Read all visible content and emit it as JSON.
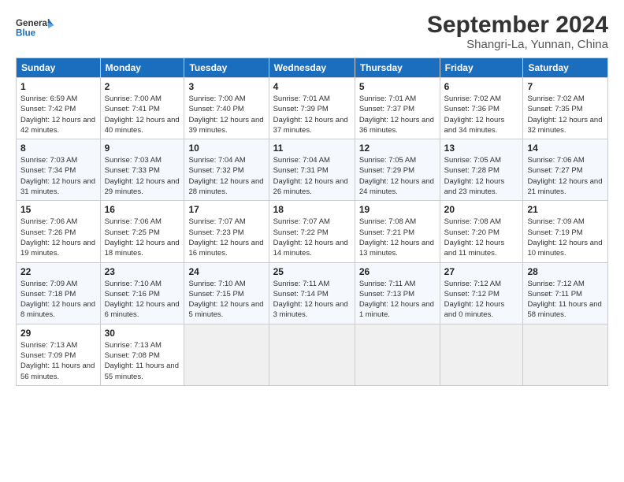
{
  "logo": {
    "line1": "General",
    "line2": "Blue"
  },
  "title": "September 2024",
  "subtitle": "Shangri-La, Yunnan, China",
  "days_of_week": [
    "Sunday",
    "Monday",
    "Tuesday",
    "Wednesday",
    "Thursday",
    "Friday",
    "Saturday"
  ],
  "weeks": [
    [
      {
        "day": "1",
        "sunrise": "6:59 AM",
        "sunset": "7:42 PM",
        "daylight": "12 hours and 42 minutes."
      },
      {
        "day": "2",
        "sunrise": "7:00 AM",
        "sunset": "7:41 PM",
        "daylight": "12 hours and 40 minutes."
      },
      {
        "day": "3",
        "sunrise": "7:00 AM",
        "sunset": "7:40 PM",
        "daylight": "12 hours and 39 minutes."
      },
      {
        "day": "4",
        "sunrise": "7:01 AM",
        "sunset": "7:39 PM",
        "daylight": "12 hours and 37 minutes."
      },
      {
        "day": "5",
        "sunrise": "7:01 AM",
        "sunset": "7:37 PM",
        "daylight": "12 hours and 36 minutes."
      },
      {
        "day": "6",
        "sunrise": "7:02 AM",
        "sunset": "7:36 PM",
        "daylight": "12 hours and 34 minutes."
      },
      {
        "day": "7",
        "sunrise": "7:02 AM",
        "sunset": "7:35 PM",
        "daylight": "12 hours and 32 minutes."
      }
    ],
    [
      {
        "day": "8",
        "sunrise": "7:03 AM",
        "sunset": "7:34 PM",
        "daylight": "12 hours and 31 minutes."
      },
      {
        "day": "9",
        "sunrise": "7:03 AM",
        "sunset": "7:33 PM",
        "daylight": "12 hours and 29 minutes."
      },
      {
        "day": "10",
        "sunrise": "7:04 AM",
        "sunset": "7:32 PM",
        "daylight": "12 hours and 28 minutes."
      },
      {
        "day": "11",
        "sunrise": "7:04 AM",
        "sunset": "7:31 PM",
        "daylight": "12 hours and 26 minutes."
      },
      {
        "day": "12",
        "sunrise": "7:05 AM",
        "sunset": "7:29 PM",
        "daylight": "12 hours and 24 minutes."
      },
      {
        "day": "13",
        "sunrise": "7:05 AM",
        "sunset": "7:28 PM",
        "daylight": "12 hours and 23 minutes."
      },
      {
        "day": "14",
        "sunrise": "7:06 AM",
        "sunset": "7:27 PM",
        "daylight": "12 hours and 21 minutes."
      }
    ],
    [
      {
        "day": "15",
        "sunrise": "7:06 AM",
        "sunset": "7:26 PM",
        "daylight": "12 hours and 19 minutes."
      },
      {
        "day": "16",
        "sunrise": "7:06 AM",
        "sunset": "7:25 PM",
        "daylight": "12 hours and 18 minutes."
      },
      {
        "day": "17",
        "sunrise": "7:07 AM",
        "sunset": "7:23 PM",
        "daylight": "12 hours and 16 minutes."
      },
      {
        "day": "18",
        "sunrise": "7:07 AM",
        "sunset": "7:22 PM",
        "daylight": "12 hours and 14 minutes."
      },
      {
        "day": "19",
        "sunrise": "7:08 AM",
        "sunset": "7:21 PM",
        "daylight": "12 hours and 13 minutes."
      },
      {
        "day": "20",
        "sunrise": "7:08 AM",
        "sunset": "7:20 PM",
        "daylight": "12 hours and 11 minutes."
      },
      {
        "day": "21",
        "sunrise": "7:09 AM",
        "sunset": "7:19 PM",
        "daylight": "12 hours and 10 minutes."
      }
    ],
    [
      {
        "day": "22",
        "sunrise": "7:09 AM",
        "sunset": "7:18 PM",
        "daylight": "12 hours and 8 minutes."
      },
      {
        "day": "23",
        "sunrise": "7:10 AM",
        "sunset": "7:16 PM",
        "daylight": "12 hours and 6 minutes."
      },
      {
        "day": "24",
        "sunrise": "7:10 AM",
        "sunset": "7:15 PM",
        "daylight": "12 hours and 5 minutes."
      },
      {
        "day": "25",
        "sunrise": "7:11 AM",
        "sunset": "7:14 PM",
        "daylight": "12 hours and 3 minutes."
      },
      {
        "day": "26",
        "sunrise": "7:11 AM",
        "sunset": "7:13 PM",
        "daylight": "12 hours and 1 minute."
      },
      {
        "day": "27",
        "sunrise": "7:12 AM",
        "sunset": "7:12 PM",
        "daylight": "12 hours and 0 minutes."
      },
      {
        "day": "28",
        "sunrise": "7:12 AM",
        "sunset": "7:11 PM",
        "daylight": "11 hours and 58 minutes."
      }
    ],
    [
      {
        "day": "29",
        "sunrise": "7:13 AM",
        "sunset": "7:09 PM",
        "daylight": "11 hours and 56 minutes."
      },
      {
        "day": "30",
        "sunrise": "7:13 AM",
        "sunset": "7:08 PM",
        "daylight": "11 hours and 55 minutes."
      },
      null,
      null,
      null,
      null,
      null
    ]
  ],
  "labels": {
    "sunrise": "Sunrise:",
    "sunset": "Sunset:",
    "daylight": "Daylight:"
  }
}
